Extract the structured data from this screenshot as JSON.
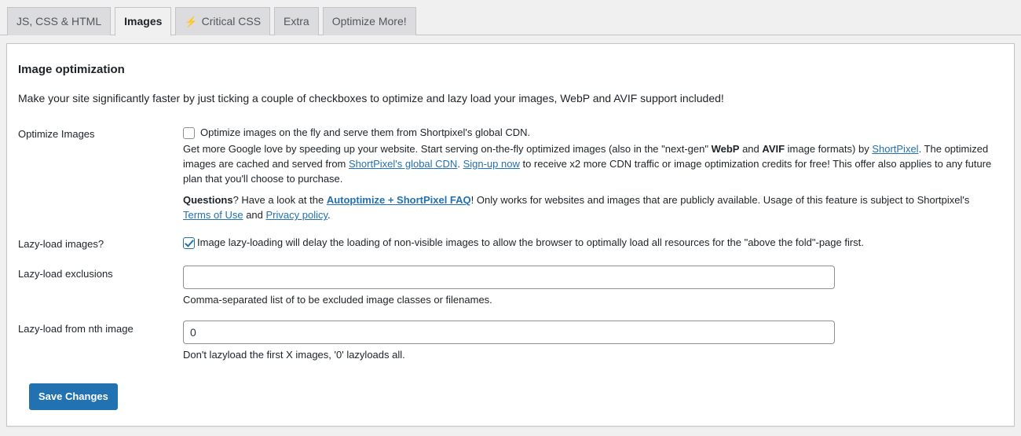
{
  "tabs": [
    {
      "label": "JS, CSS & HTML",
      "active": false,
      "icon": null
    },
    {
      "label": "Images",
      "active": true,
      "icon": null
    },
    {
      "label": "Critical CSS",
      "active": false,
      "icon": "bolt-icon",
      "icon_glyph": "⚡"
    },
    {
      "label": "Extra",
      "active": false,
      "icon": null
    },
    {
      "label": "Optimize More!",
      "active": false,
      "icon": null
    }
  ],
  "section": {
    "title": "Image optimization",
    "intro": "Make your site significantly faster by just ticking a couple of checkboxes to optimize and lazy load your images, WebP and AVIF support included!"
  },
  "optimize_images": {
    "label": "Optimize Images",
    "checkbox_checked": false,
    "checkbox_label": "Optimize images on the fly and serve them from Shortpixel's global CDN.",
    "desc_p1": {
      "t1": "Get more Google love by speeding up your website. Start serving on-the-fly optimized images (also in the \"next-gen\" ",
      "b1": "WebP",
      "t2": " and ",
      "b2": "AVIF",
      "t3": " image formats) by ",
      "link1": "ShortPixel",
      "t4": ". The optimized images are cached and served from ",
      "link2": "ShortPixel's global CDN",
      "t5": ". ",
      "link3": "Sign-up now",
      "t6": " to receive x2 more CDN traffic or image optimization credits for free! This offer also applies to any future plan that you'll choose to purchase."
    },
    "desc_p2": {
      "b1": "Questions",
      "t1": "? Have a look at the ",
      "link1": "Autoptimize + ShortPixel FAQ",
      "t2": "! Only works for websites and images that are publicly available. Usage of this feature is subject to Shortpixel's ",
      "link2": "Terms of Use",
      "t3": " and ",
      "link3": "Privacy policy",
      "t4": "."
    }
  },
  "lazy_load": {
    "label": "Lazy-load images?",
    "checkbox_checked": true,
    "checkbox_label": "Image lazy-loading will delay the loading of non-visible images to allow the browser to optimally load all resources for the \"above the fold\"-page first."
  },
  "lazy_exclusions": {
    "label": "Lazy-load exclusions",
    "value": "",
    "placeholder": "",
    "help": "Comma-separated list of to be excluded image classes or filenames."
  },
  "lazy_nth": {
    "label": "Lazy-load from nth image",
    "value": "0",
    "placeholder": "",
    "help": "Don't lazyload the first X images, '0' lazyloads all."
  },
  "submit": {
    "save_label": "Save Changes"
  },
  "colors": {
    "primary": "#2271b1",
    "link": "#2271b1",
    "page_bg": "#f0f0f1",
    "card_bg": "#ffffff",
    "border": "#c3c4c7",
    "bolt": "#f0b849"
  }
}
